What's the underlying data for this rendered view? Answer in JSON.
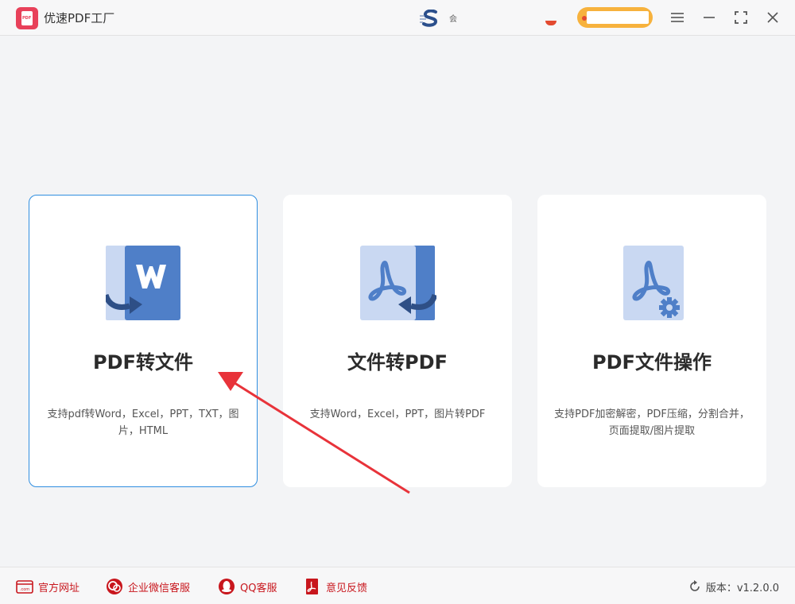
{
  "app": {
    "title": "优速PDF工厂"
  },
  "header": {
    "center_glyph": "会"
  },
  "cards": [
    {
      "title": "PDF转文件",
      "desc": "支持pdf转Word，Excel，PPT，TXT，图片，HTML",
      "icon": "pdf-to-word-icon"
    },
    {
      "title": "文件转PDF",
      "desc": "支持Word，Excel，PPT，图片转PDF",
      "icon": "file-to-pdf-icon"
    },
    {
      "title": "PDF文件操作",
      "desc": "支持PDF加密解密，PDF压缩，分割合并，页面提取/图片提取",
      "icon": "pdf-settings-icon"
    }
  ],
  "footer": {
    "links": [
      {
        "label": "官方网址",
        "icon": "website-icon"
      },
      {
        "label": "企业微信客服",
        "icon": "wechat-service-icon"
      },
      {
        "label": "QQ客服",
        "icon": "qq-icon"
      },
      {
        "label": "意见反馈",
        "icon": "feedback-icon"
      }
    ],
    "version": "版本：v1.2.0.0"
  },
  "colors": {
    "accent": "#2f8ee0",
    "brand": "#e8415a",
    "footer_link": "#c8161d",
    "icon_blue": "#4f7fc8",
    "icon_light": "#c9d8f2",
    "annotation_arrow": "#e8333a"
  }
}
